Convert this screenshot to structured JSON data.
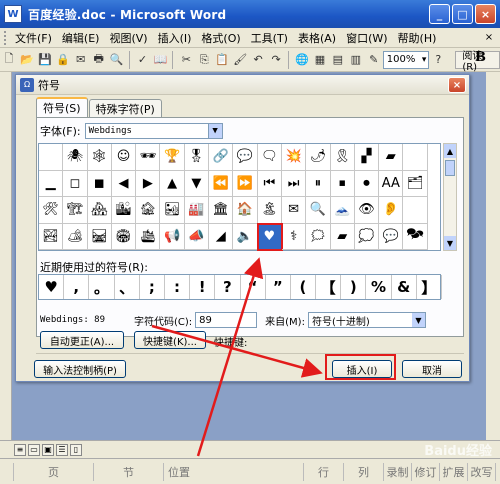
{
  "window": {
    "title": "百度经验.doc - Microsoft Word",
    "app_icon": "W"
  },
  "menu": [
    "文件(F)",
    "编辑(E)",
    "视图(V)",
    "插入(I)",
    "格式(O)",
    "工具(T)",
    "表格(A)",
    "窗口(W)",
    "帮助(H)"
  ],
  "toolbar": {
    "zoom": "100%",
    "read_label": "阅读(R)",
    "bold_label": "B"
  },
  "dialog": {
    "title": "符号",
    "close": "×",
    "tabs": [
      "符号(S)",
      "特殊字符(P)"
    ],
    "font_label": "字体(F):",
    "font_value": "Webdings",
    "symbols": [
      "",
      "🕷",
      "🕸",
      "☺",
      "🕶",
      "🏆",
      "🎖",
      "🔗",
      "💬",
      "🗨",
      "💥",
      "🌶",
      "🎗",
      "▞",
      "▰",
      "",
      "▁",
      "◻",
      "◼",
      "◀",
      "▶",
      "▲",
      "▼",
      "⏪",
      "⏩",
      "⏮",
      "⏭",
      "⏸",
      "⏹",
      "⏺",
      "AA",
      "🗂",
      "🛠",
      "🏗",
      "🏘",
      "🏙",
      "🏚",
      "🏜",
      "🏭",
      "🏛",
      "🏠",
      "🏝",
      "✉",
      "🔍",
      "🗻",
      "👁",
      "👂",
      "",
      "🏞",
      "🏕",
      "🛤",
      "🏟",
      "🛳",
      "📢",
      "📣",
      "◢",
      "🔈",
      "♥",
      "⚕",
      "🗯",
      "▰",
      "💭",
      "💬",
      "🗫"
    ],
    "selected_index": 57,
    "recent_label": "近期使用过的符号(R):",
    "recent": [
      "♥",
      ",",
      "。",
      "、",
      ";",
      ":",
      "!",
      "?",
      "“",
      "”",
      "(",
      "【",
      ")",
      "%",
      "&",
      "】"
    ],
    "info_font": "Webdings: 89",
    "code_label": "字符代码(C):",
    "code_value": "89",
    "from_label": "来自(M):",
    "from_value": "符号(十进制)",
    "autocorrect": "自动更正(A)...",
    "shortcut_btn": "快捷键(K)...",
    "shortcut_label": "快捷键:",
    "ime_btn": "输入法控制柄(P)",
    "insert": "插入(I)",
    "cancel": "取消"
  },
  "status": {
    "page": "页",
    "section": "节",
    "position": "位置",
    "line": "行",
    "col": "列",
    "rec": "录制",
    "trk": "修订",
    "ext": "扩展",
    "ovr": "改写"
  },
  "watermark": "Baidu经验"
}
